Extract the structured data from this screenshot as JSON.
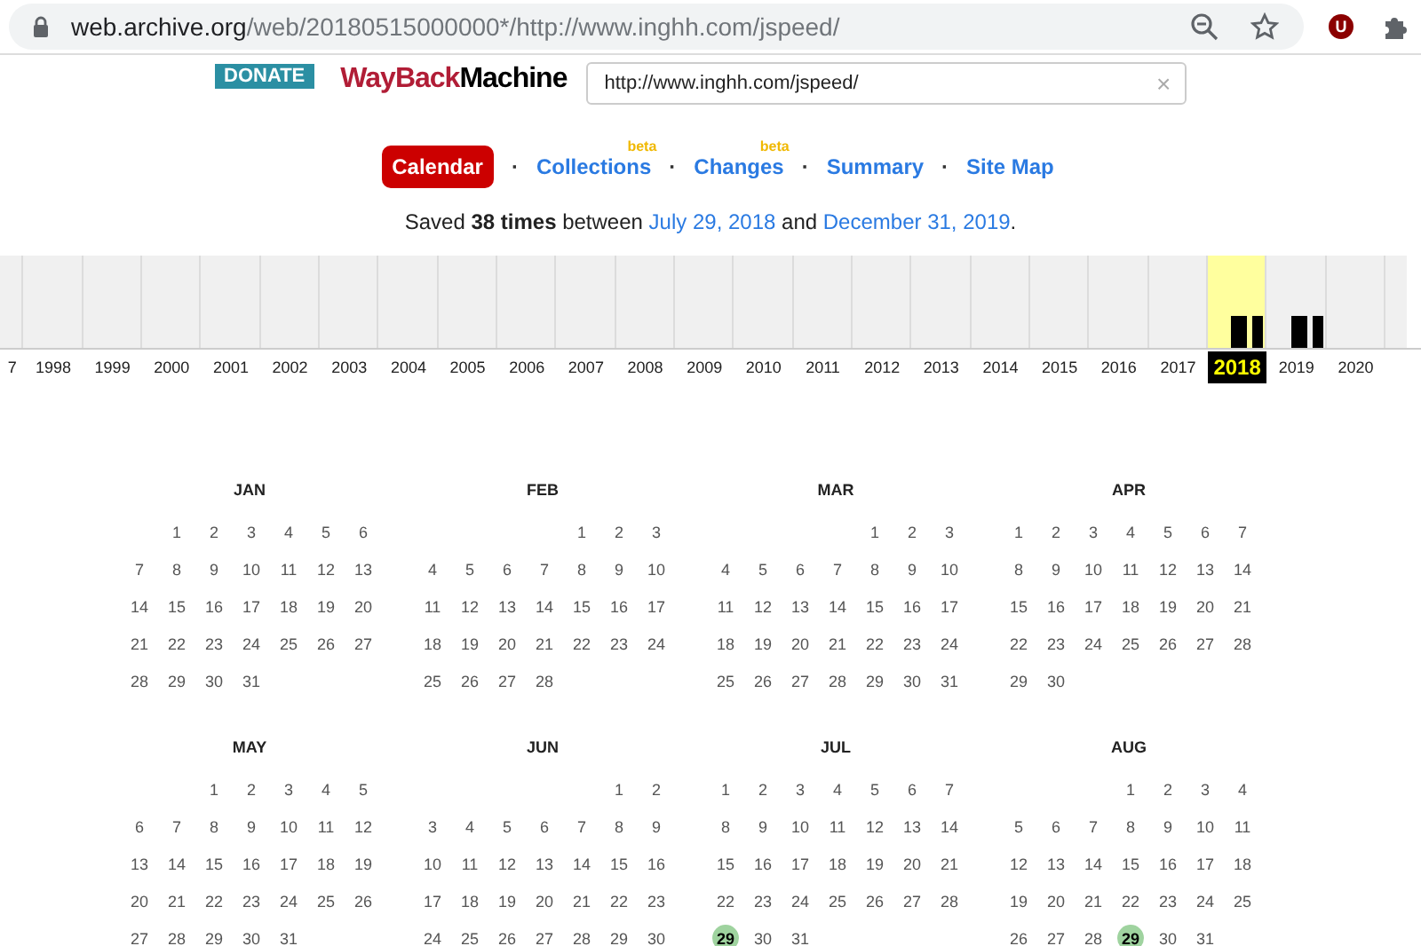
{
  "browser": {
    "address_host": "web.archive.org",
    "address_path": "/web/20180515000000*/http://www.inghh.com/jspeed/",
    "extension_badge": "U"
  },
  "header": {
    "donate": "DONATE",
    "logo_first": "WayBack",
    "logo_second": "Machine",
    "search_value": "http://www.inghh.com/jspeed/",
    "clear": "×"
  },
  "nav": [
    {
      "label": "Calendar",
      "selected": true
    },
    {
      "label": "Collections",
      "selected": false,
      "badge": "beta"
    },
    {
      "label": "Changes",
      "selected": false,
      "badge": "beta"
    },
    {
      "label": "Summary",
      "selected": false
    },
    {
      "label": "Site Map",
      "selected": false
    }
  ],
  "nav_separator": "·",
  "summary": {
    "before": "Saved ",
    "count": "38 times",
    "middle": " between ",
    "first": "July 29, 2018",
    "and": " and ",
    "last": "December 31, 2019",
    "end": "."
  },
  "timeline": [
    {
      "year": "7",
      "selected": false,
      "captures": false
    },
    {
      "year": "1998",
      "selected": false,
      "captures": false
    },
    {
      "year": "1999",
      "selected": false,
      "captures": false
    },
    {
      "year": "2000",
      "selected": false,
      "captures": false
    },
    {
      "year": "2001",
      "selected": false,
      "captures": false
    },
    {
      "year": "2002",
      "selected": false,
      "captures": false
    },
    {
      "year": "2003",
      "selected": false,
      "captures": false
    },
    {
      "year": "2004",
      "selected": false,
      "captures": false
    },
    {
      "year": "2005",
      "selected": false,
      "captures": false
    },
    {
      "year": "2006",
      "selected": false,
      "captures": false
    },
    {
      "year": "2007",
      "selected": false,
      "captures": false
    },
    {
      "year": "2008",
      "selected": false,
      "captures": false
    },
    {
      "year": "2009",
      "selected": false,
      "captures": false
    },
    {
      "year": "2010",
      "selected": false,
      "captures": false
    },
    {
      "year": "2011",
      "selected": false,
      "captures": false
    },
    {
      "year": "2012",
      "selected": false,
      "captures": false
    },
    {
      "year": "2013",
      "selected": false,
      "captures": false
    },
    {
      "year": "2014",
      "selected": false,
      "captures": false
    },
    {
      "year": "2015",
      "selected": false,
      "captures": false
    },
    {
      "year": "2016",
      "selected": false,
      "captures": false
    },
    {
      "year": "2017",
      "selected": false,
      "captures": false
    },
    {
      "year": "2018",
      "selected": true,
      "captures": true
    },
    {
      "year": "2019",
      "selected": false,
      "captures": true
    },
    {
      "year": "2020",
      "selected": false,
      "captures": false
    }
  ],
  "months": [
    {
      "name": "JAN",
      "weeks": [
        [
          {
            "day": "1",
            "captured": false
          },
          {
            "day": "2",
            "captured": false
          },
          {
            "day": "3",
            "captured": false
          },
          {
            "day": "4",
            "captured": false
          },
          {
            "day": "5",
            "captured": false
          },
          {
            "day": "6",
            "captured": false
          }
        ],
        [
          {
            "day": "7",
            "captured": false
          },
          {
            "day": "8",
            "captured": false
          },
          {
            "day": "9",
            "captured": false
          },
          {
            "day": "10",
            "captured": false
          },
          {
            "day": "11",
            "captured": false
          },
          {
            "day": "12",
            "captured": false
          },
          {
            "day": "13",
            "captured": false
          }
        ],
        [
          {
            "day": "14",
            "captured": false
          },
          {
            "day": "15",
            "captured": false
          },
          {
            "day": "16",
            "captured": false
          },
          {
            "day": "17",
            "captured": false
          },
          {
            "day": "18",
            "captured": false
          },
          {
            "day": "19",
            "captured": false
          },
          {
            "day": "20",
            "captured": false
          }
        ],
        [
          {
            "day": "21",
            "captured": false
          },
          {
            "day": "22",
            "captured": false
          },
          {
            "day": "23",
            "captured": false
          },
          {
            "day": "24",
            "captured": false
          },
          {
            "day": "25",
            "captured": false
          },
          {
            "day": "26",
            "captured": false
          },
          {
            "day": "27",
            "captured": false
          }
        ],
        [
          {
            "day": "28",
            "captured": false
          },
          {
            "day": "29",
            "captured": false
          },
          {
            "day": "30",
            "captured": false
          },
          {
            "day": "31",
            "captured": false
          }
        ]
      ]
    },
    {
      "name": "FEB",
      "weeks": [
        [
          {
            "day": "1",
            "captured": false
          },
          {
            "day": "2",
            "captured": false
          },
          {
            "day": "3",
            "captured": false
          }
        ],
        [
          {
            "day": "4",
            "captured": false
          },
          {
            "day": "5",
            "captured": false
          },
          {
            "day": "6",
            "captured": false
          },
          {
            "day": "7",
            "captured": false
          },
          {
            "day": "8",
            "captured": false
          },
          {
            "day": "9",
            "captured": false
          },
          {
            "day": "10",
            "captured": false
          }
        ],
        [
          {
            "day": "11",
            "captured": false
          },
          {
            "day": "12",
            "captured": false
          },
          {
            "day": "13",
            "captured": false
          },
          {
            "day": "14",
            "captured": false
          },
          {
            "day": "15",
            "captured": false
          },
          {
            "day": "16",
            "captured": false
          },
          {
            "day": "17",
            "captured": false
          }
        ],
        [
          {
            "day": "18",
            "captured": false
          },
          {
            "day": "19",
            "captured": false
          },
          {
            "day": "20",
            "captured": false
          },
          {
            "day": "21",
            "captured": false
          },
          {
            "day": "22",
            "captured": false
          },
          {
            "day": "23",
            "captured": false
          },
          {
            "day": "24",
            "captured": false
          }
        ],
        [
          {
            "day": "25",
            "captured": false
          },
          {
            "day": "26",
            "captured": false
          },
          {
            "day": "27",
            "captured": false
          },
          {
            "day": "28",
            "captured": false
          }
        ]
      ]
    },
    {
      "name": "MAR",
      "weeks": [
        [
          {
            "day": "1",
            "captured": false
          },
          {
            "day": "2",
            "captured": false
          },
          {
            "day": "3",
            "captured": false
          }
        ],
        [
          {
            "day": "4",
            "captured": false
          },
          {
            "day": "5",
            "captured": false
          },
          {
            "day": "6",
            "captured": false
          },
          {
            "day": "7",
            "captured": false
          },
          {
            "day": "8",
            "captured": false
          },
          {
            "day": "9",
            "captured": false
          },
          {
            "day": "10",
            "captured": false
          }
        ],
        [
          {
            "day": "11",
            "captured": false
          },
          {
            "day": "12",
            "captured": false
          },
          {
            "day": "13",
            "captured": false
          },
          {
            "day": "14",
            "captured": false
          },
          {
            "day": "15",
            "captured": false
          },
          {
            "day": "16",
            "captured": false
          },
          {
            "day": "17",
            "captured": false
          }
        ],
        [
          {
            "day": "18",
            "captured": false
          },
          {
            "day": "19",
            "captured": false
          },
          {
            "day": "20",
            "captured": false
          },
          {
            "day": "21",
            "captured": false
          },
          {
            "day": "22",
            "captured": false
          },
          {
            "day": "23",
            "captured": false
          },
          {
            "day": "24",
            "captured": false
          }
        ],
        [
          {
            "day": "25",
            "captured": false
          },
          {
            "day": "26",
            "captured": false
          },
          {
            "day": "27",
            "captured": false
          },
          {
            "day": "28",
            "captured": false
          },
          {
            "day": "29",
            "captured": false
          },
          {
            "day": "30",
            "captured": false
          },
          {
            "day": "31",
            "captured": false
          }
        ]
      ]
    },
    {
      "name": "APR",
      "weeks": [
        [
          {
            "day": "1",
            "captured": false
          },
          {
            "day": "2",
            "captured": false
          },
          {
            "day": "3",
            "captured": false
          },
          {
            "day": "4",
            "captured": false
          },
          {
            "day": "5",
            "captured": false
          },
          {
            "day": "6",
            "captured": false
          },
          {
            "day": "7",
            "captured": false
          }
        ],
        [
          {
            "day": "8",
            "captured": false
          },
          {
            "day": "9",
            "captured": false
          },
          {
            "day": "10",
            "captured": false
          },
          {
            "day": "11",
            "captured": false
          },
          {
            "day": "12",
            "captured": false
          },
          {
            "day": "13",
            "captured": false
          },
          {
            "day": "14",
            "captured": false
          }
        ],
        [
          {
            "day": "15",
            "captured": false
          },
          {
            "day": "16",
            "captured": false
          },
          {
            "day": "17",
            "captured": false
          },
          {
            "day": "18",
            "captured": false
          },
          {
            "day": "19",
            "captured": false
          },
          {
            "day": "20",
            "captured": false
          },
          {
            "day": "21",
            "captured": false
          }
        ],
        [
          {
            "day": "22",
            "captured": false
          },
          {
            "day": "23",
            "captured": false
          },
          {
            "day": "24",
            "captured": false
          },
          {
            "day": "25",
            "captured": false
          },
          {
            "day": "26",
            "captured": false
          },
          {
            "day": "27",
            "captured": false
          },
          {
            "day": "28",
            "captured": false
          }
        ],
        [
          {
            "day": "29",
            "captured": false
          },
          {
            "day": "30",
            "captured": false
          }
        ]
      ]
    },
    {
      "name": "MAY",
      "weeks": [
        [
          {
            "day": "1",
            "captured": false
          },
          {
            "day": "2",
            "captured": false
          },
          {
            "day": "3",
            "captured": false
          },
          {
            "day": "4",
            "captured": false
          },
          {
            "day": "5",
            "captured": false
          }
        ],
        [
          {
            "day": "6",
            "captured": false
          },
          {
            "day": "7",
            "captured": false
          },
          {
            "day": "8",
            "captured": false
          },
          {
            "day": "9",
            "captured": false
          },
          {
            "day": "10",
            "captured": false
          },
          {
            "day": "11",
            "captured": false
          },
          {
            "day": "12",
            "captured": false
          }
        ],
        [
          {
            "day": "13",
            "captured": false
          },
          {
            "day": "14",
            "captured": false
          },
          {
            "day": "15",
            "captured": false
          },
          {
            "day": "16",
            "captured": false
          },
          {
            "day": "17",
            "captured": false
          },
          {
            "day": "18",
            "captured": false
          },
          {
            "day": "19",
            "captured": false
          }
        ],
        [
          {
            "day": "20",
            "captured": false
          },
          {
            "day": "21",
            "captured": false
          },
          {
            "day": "22",
            "captured": false
          },
          {
            "day": "23",
            "captured": false
          },
          {
            "day": "24",
            "captured": false
          },
          {
            "day": "25",
            "captured": false
          },
          {
            "day": "26",
            "captured": false
          }
        ],
        [
          {
            "day": "27",
            "captured": false
          },
          {
            "day": "28",
            "captured": false
          },
          {
            "day": "29",
            "captured": false
          },
          {
            "day": "30",
            "captured": false
          },
          {
            "day": "31",
            "captured": false
          }
        ]
      ]
    },
    {
      "name": "JUN",
      "weeks": [
        [
          {
            "day": "1",
            "captured": false
          },
          {
            "day": "2",
            "captured": false
          }
        ],
        [
          {
            "day": "3",
            "captured": false
          },
          {
            "day": "4",
            "captured": false
          },
          {
            "day": "5",
            "captured": false
          },
          {
            "day": "6",
            "captured": false
          },
          {
            "day": "7",
            "captured": false
          },
          {
            "day": "8",
            "captured": false
          },
          {
            "day": "9",
            "captured": false
          }
        ],
        [
          {
            "day": "10",
            "captured": false
          },
          {
            "day": "11",
            "captured": false
          },
          {
            "day": "12",
            "captured": false
          },
          {
            "day": "13",
            "captured": false
          },
          {
            "day": "14",
            "captured": false
          },
          {
            "day": "15",
            "captured": false
          },
          {
            "day": "16",
            "captured": false
          }
        ],
        [
          {
            "day": "17",
            "captured": false
          },
          {
            "day": "18",
            "captured": false
          },
          {
            "day": "19",
            "captured": false
          },
          {
            "day": "20",
            "captured": false
          },
          {
            "day": "21",
            "captured": false
          },
          {
            "day": "22",
            "captured": false
          },
          {
            "day": "23",
            "captured": false
          }
        ],
        [
          {
            "day": "24",
            "captured": false
          },
          {
            "day": "25",
            "captured": false
          },
          {
            "day": "26",
            "captured": false
          },
          {
            "day": "27",
            "captured": false
          },
          {
            "day": "28",
            "captured": false
          },
          {
            "day": "29",
            "captured": false
          },
          {
            "day": "30",
            "captured": false
          }
        ]
      ]
    },
    {
      "name": "JUL",
      "weeks": [
        [
          {
            "day": "1",
            "captured": false
          },
          {
            "day": "2",
            "captured": false
          },
          {
            "day": "3",
            "captured": false
          },
          {
            "day": "4",
            "captured": false
          },
          {
            "day": "5",
            "captured": false
          },
          {
            "day": "6",
            "captured": false
          },
          {
            "day": "7",
            "captured": false
          }
        ],
        [
          {
            "day": "8",
            "captured": false
          },
          {
            "day": "9",
            "captured": false
          },
          {
            "day": "10",
            "captured": false
          },
          {
            "day": "11",
            "captured": false
          },
          {
            "day": "12",
            "captured": false
          },
          {
            "day": "13",
            "captured": false
          },
          {
            "day": "14",
            "captured": false
          }
        ],
        [
          {
            "day": "15",
            "captured": false
          },
          {
            "day": "16",
            "captured": false
          },
          {
            "day": "17",
            "captured": false
          },
          {
            "day": "18",
            "captured": false
          },
          {
            "day": "19",
            "captured": false
          },
          {
            "day": "20",
            "captured": false
          },
          {
            "day": "21",
            "captured": false
          }
        ],
        [
          {
            "day": "22",
            "captured": false
          },
          {
            "day": "23",
            "captured": false
          },
          {
            "day": "24",
            "captured": false
          },
          {
            "day": "25",
            "captured": false
          },
          {
            "day": "26",
            "captured": false
          },
          {
            "day": "27",
            "captured": false
          },
          {
            "day": "28",
            "captured": false
          }
        ],
        [
          {
            "day": "29",
            "captured": true
          },
          {
            "day": "30",
            "captured": false
          },
          {
            "day": "31",
            "captured": false
          }
        ]
      ]
    },
    {
      "name": "AUG",
      "weeks": [
        [
          {
            "day": "1",
            "captured": false
          },
          {
            "day": "2",
            "captured": false
          },
          {
            "day": "3",
            "captured": false
          },
          {
            "day": "4",
            "captured": false
          }
        ],
        [
          {
            "day": "5",
            "captured": false
          },
          {
            "day": "6",
            "captured": false
          },
          {
            "day": "7",
            "captured": false
          },
          {
            "day": "8",
            "captured": false
          },
          {
            "day": "9",
            "captured": false
          },
          {
            "day": "10",
            "captured": false
          },
          {
            "day": "11",
            "captured": false
          }
        ],
        [
          {
            "day": "12",
            "captured": false
          },
          {
            "day": "13",
            "captured": false
          },
          {
            "day": "14",
            "captured": false
          },
          {
            "day": "15",
            "captured": false
          },
          {
            "day": "16",
            "captured": false
          },
          {
            "day": "17",
            "captured": false
          },
          {
            "day": "18",
            "captured": false
          }
        ],
        [
          {
            "day": "19",
            "captured": false
          },
          {
            "day": "20",
            "captured": false
          },
          {
            "day": "21",
            "captured": false
          },
          {
            "day": "22",
            "captured": false
          },
          {
            "day": "23",
            "captured": false
          },
          {
            "day": "24",
            "captured": false
          },
          {
            "day": "25",
            "captured": false
          }
        ],
        [
          {
            "day": "26",
            "captured": false
          },
          {
            "day": "27",
            "captured": false
          },
          {
            "day": "28",
            "captured": false
          },
          {
            "day": "29",
            "captured": true
          },
          {
            "day": "30",
            "captured": false
          },
          {
            "day": "31",
            "captured": false
          }
        ]
      ]
    }
  ]
}
